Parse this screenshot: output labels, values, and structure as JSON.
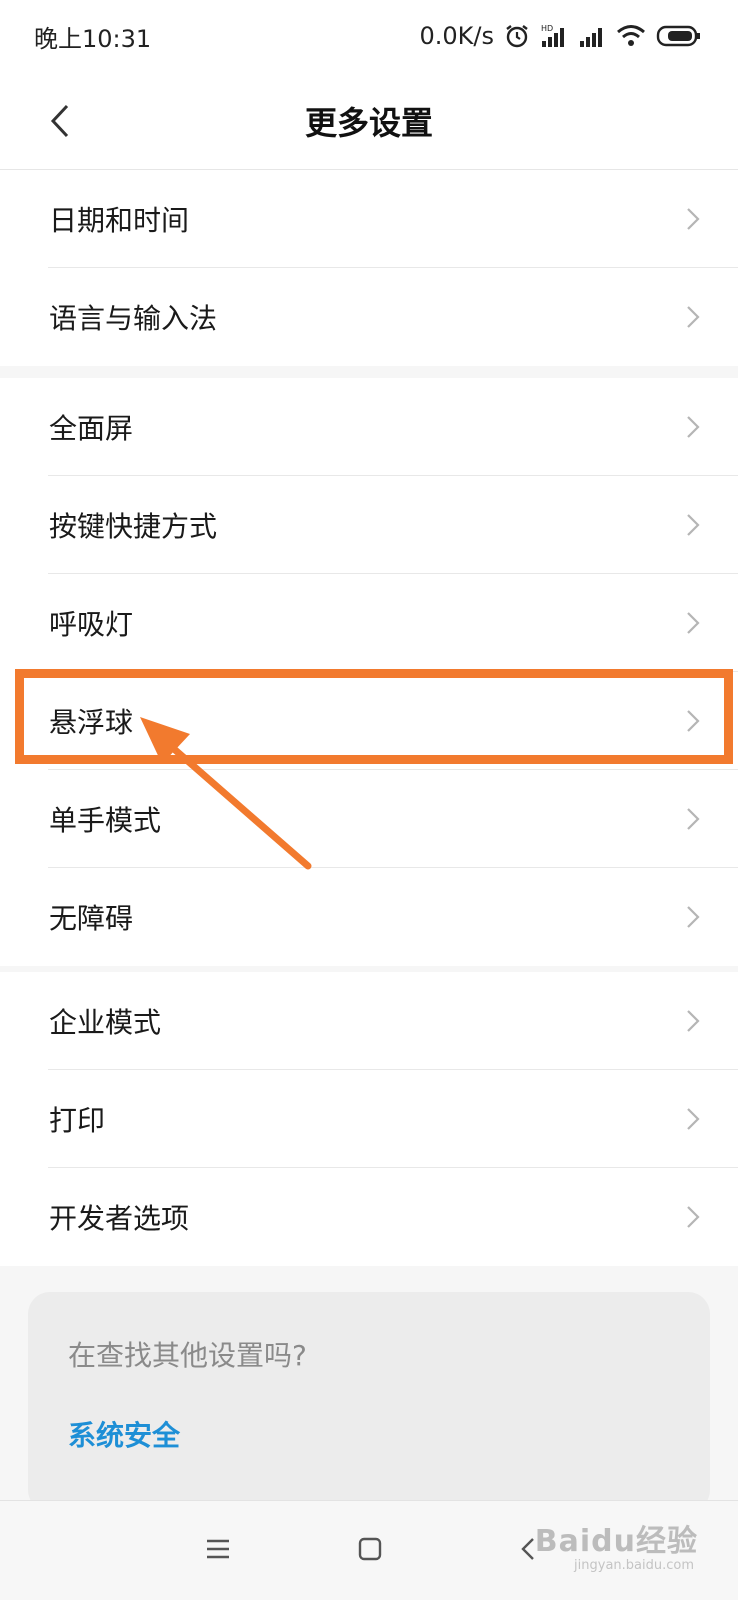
{
  "status_bar": {
    "time": "晚上10:31",
    "net_speed": "0.0K/s"
  },
  "header": {
    "title": "更多设置"
  },
  "sections": [
    {
      "items": [
        "日期和时间",
        "语言与输入法"
      ]
    },
    {
      "items": [
        "全面屏",
        "按键快捷方式",
        "呼吸灯",
        "悬浮球",
        "单手模式",
        "无障碍"
      ]
    },
    {
      "items": [
        "企业模式",
        "打印",
        "开发者选项"
      ]
    }
  ],
  "search_card": {
    "hint": "在查找其他设置吗?",
    "link": "系统安全"
  },
  "watermark": {
    "brand": "Baidu经验",
    "url": "jingyan.baidu.com"
  },
  "colors": {
    "highlight": "#f27a2e",
    "link": "#1e8fd6"
  },
  "highlighted_item": "悬浮球"
}
